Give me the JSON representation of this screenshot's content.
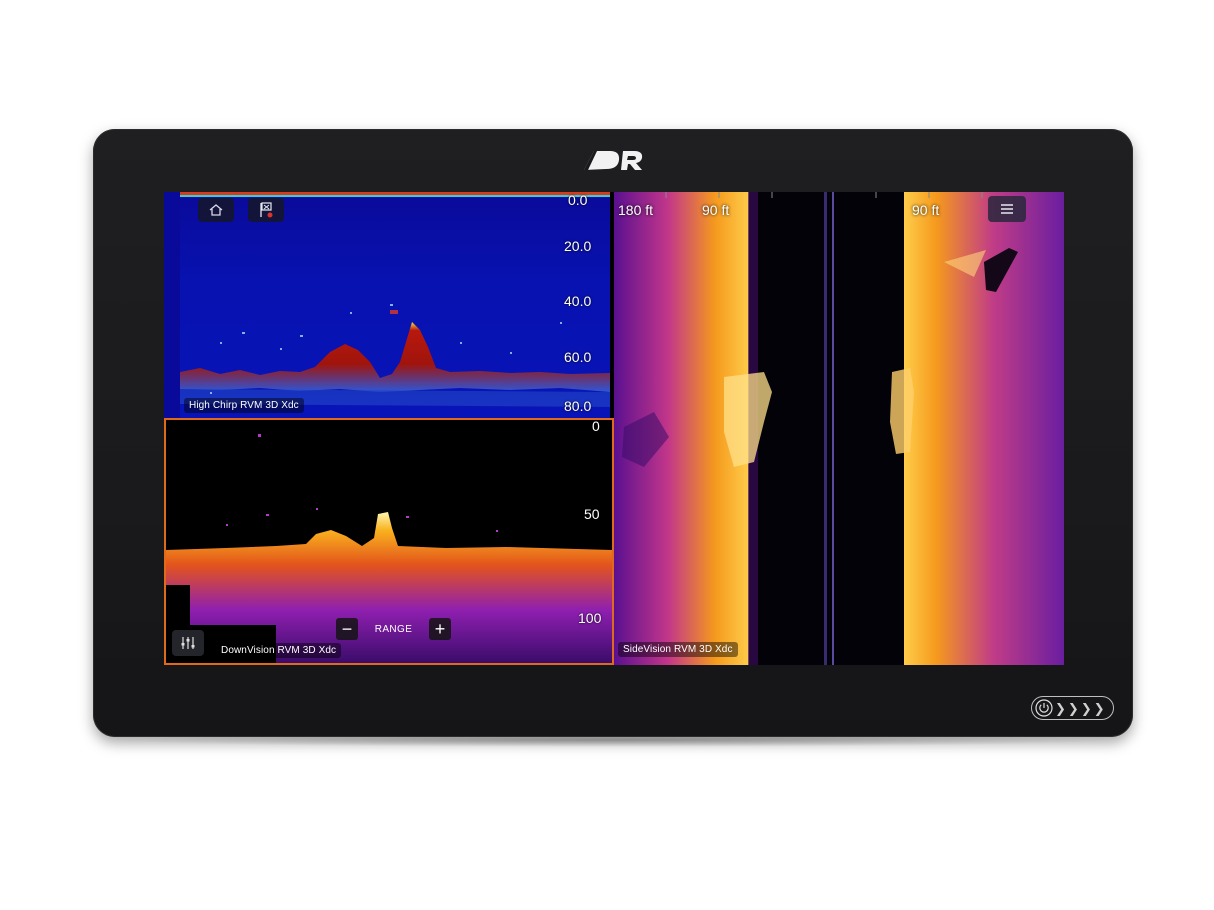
{
  "brand": {
    "logo_text": "R"
  },
  "chirp": {
    "label": "High Chirp RVM 3D Xdc",
    "depths": [
      "0.0",
      "20.0",
      "40.0",
      "60.0",
      "80.0"
    ]
  },
  "down": {
    "label": "DownVision RVM 3D Xdc",
    "depths": [
      "0",
      "50",
      "100"
    ],
    "range_label": "RANGE",
    "range_minus": "−",
    "range_plus": "+"
  },
  "side": {
    "label": "SideVision RVM 3D Xdc",
    "range_left_outer": "180 ft",
    "range_left_inner": "90 ft",
    "range_right": "90 ft"
  },
  "colors": {
    "bezel": "#1a1a1c",
    "chirp_water": "#0914b8",
    "chirp_bottom": "#b01a10",
    "sonar_orange": "#f7a21a",
    "sonar_purple": "#7a1fb0",
    "active_border": "#e06a1c"
  },
  "icons": {
    "home": "home-icon",
    "waypoint": "waypoint-flag-icon",
    "menu": "menu-icon",
    "settings": "sliders-icon",
    "power": "power-icon"
  }
}
